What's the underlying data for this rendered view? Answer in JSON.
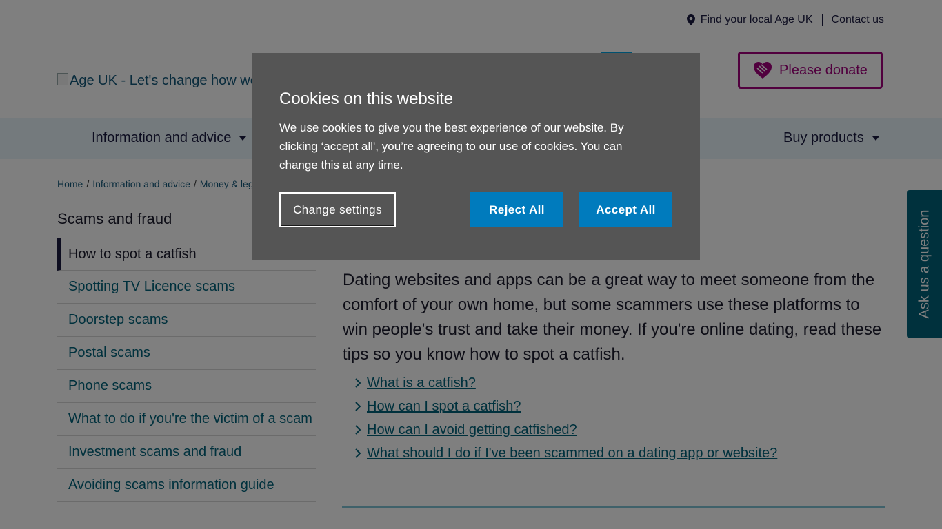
{
  "utility": {
    "find_local": "Find your local Age UK",
    "contact": "Contact us"
  },
  "logo": {
    "alt_text": "Age UK - Let's change how we"
  },
  "donate": {
    "label": "Please donate"
  },
  "nav": {
    "info_advice": "Information and advice",
    "buy_products": "Buy products"
  },
  "breadcrumb": [
    "Home",
    "Information and advice",
    "Money & leg"
  ],
  "sidebar": {
    "title": "Scams and fraud",
    "items": [
      "How to spot a catfish",
      "Spotting TV Licence scams",
      "Doorstep scams",
      "Postal scams",
      "Phone scams",
      "What to do if you're the victim of a scam",
      "Investment scams and fraud",
      "Avoiding scams information guide"
    ]
  },
  "main": {
    "intro": "Dating websites and apps can be a great way to meet someone from the comfort of your own home, but some scammers use these platforms to win people's trust and take their money. If you're online dating, read these tips so you know how to spot a catfish.",
    "links": [
      "What is a catfish?",
      "How can I spot a catfish?",
      "How can I avoid getting catfished?",
      "What should I do if I've been scammed on a dating app or website?"
    ]
  },
  "ask": {
    "label": "Ask us a question"
  },
  "cookie": {
    "title": "Cookies on this website",
    "body": "We use cookies to give you the best experience of our website. By clicking ‘accept all', you’re agreeing to our use of cookies. You can change this at any time.",
    "settings": "Change settings",
    "reject": "Reject All",
    "accept": "Accept All"
  },
  "colors": {
    "brand_magenta": "#a2007d",
    "link_teal": "#00627a",
    "button_blue": "#007bbd",
    "modal_bg": "#555555"
  }
}
